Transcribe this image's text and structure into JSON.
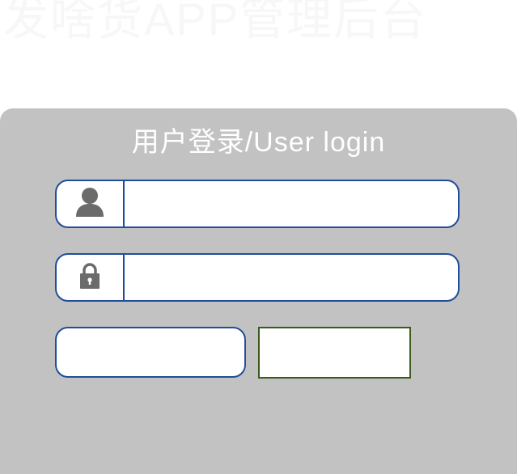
{
  "header": {
    "app_title": "发啥货APP管理后台"
  },
  "login": {
    "heading": "用户登录/User login",
    "username": {
      "icon": "user-icon",
      "value": "",
      "placeholder": ""
    },
    "password": {
      "icon": "lock-icon",
      "value": "",
      "placeholder": ""
    },
    "captcha": {
      "value": "",
      "placeholder": ""
    }
  },
  "colors": {
    "panel_background": "#c2c2c2",
    "field_border": "#1f4e9c",
    "captcha_border": "#3c5a1e",
    "icon_fill": "#6b6b6b"
  }
}
